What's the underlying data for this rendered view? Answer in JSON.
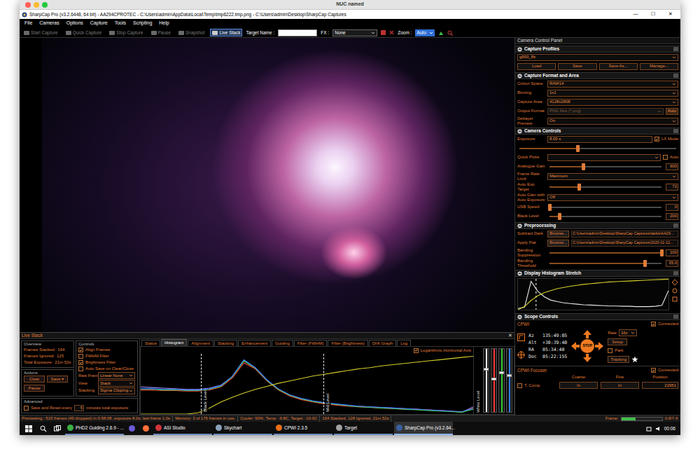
{
  "mac_window": {
    "title": "NUC named"
  },
  "window": {
    "title": "SharpCap Pro (v3.2.6448, 64 bit) - AA294CPROTEC - C:\\Users\\admin\\AppData\\Local\\Temp\\tmp6222.tmp.png - C:\\Users\\admin\\Desktop\\SharpCap Captures",
    "controls": [
      "—",
      "☐",
      "✕"
    ]
  },
  "menu": [
    "File",
    "Cameras",
    "Options",
    "Capture",
    "Tools",
    "Scripting",
    "Help"
  ],
  "toolbar": {
    "buttons": [
      {
        "label": "Start Capture",
        "disabled": true,
        "selected": false
      },
      {
        "label": "Quick Capture",
        "disabled": true,
        "selected": false
      },
      {
        "label": "Stop Capture",
        "disabled": true,
        "selected": false
      },
      {
        "label": "Pause",
        "disabled": true,
        "selected": false
      },
      {
        "label": "Snapshot",
        "disabled": true,
        "selected": false
      },
      {
        "label": "Live Stack",
        "disabled": false,
        "selected": true
      }
    ],
    "target_label": "Target Name :",
    "fx_label": "FX :",
    "fx_value": "None",
    "zoom_label": "Zoom :",
    "zoom_value": "Auto"
  },
  "camera_panel": {
    "title": "Camera Control Panel",
    "sections": [
      {
        "title": "Capture Profiles",
        "expanded": true,
        "rows": [
          {
            "kind": "select",
            "value": "g900_8s",
            "disabled": false
          },
          {
            "kind": "buttons",
            "buttons": [
              "Load",
              "Save",
              "Save As...",
              "Manage..."
            ]
          }
        ]
      },
      {
        "title": "Capture Format and Area",
        "expanded": true,
        "rows": [
          {
            "kind": "select",
            "label": "Colour Space",
            "value": "RAW14",
            "disabled": false
          },
          {
            "kind": "select",
            "label": "Binning",
            "value": "1x1",
            "disabled": false
          },
          {
            "kind": "select",
            "label": "Capture Area",
            "value": "4128x2808",
            "disabled": false
          },
          {
            "kind": "select",
            "label": "Output Format",
            "value": "PNG files (*.png)",
            "disabled": true,
            "button": "Auto"
          },
          {
            "kind": "select",
            "label": "Debayer Preview",
            "value": "On",
            "disabled": false
          }
        ]
      },
      {
        "title": "Camera Controls",
        "expanded": true,
        "rows": [
          {
            "kind": "input_check",
            "label": "Exposure",
            "value": "8.00 s",
            "check": "LX Mode",
            "checked": true
          },
          {
            "kind": "slider",
            "level": 0.37
          },
          {
            "kind": "select_check",
            "label": "Quick Picks",
            "check": "Auto",
            "checked": false
          },
          {
            "kind": "slider",
            "label": "Analogue Gain",
            "reading": "900",
            "level": 0.3
          },
          {
            "kind": "select",
            "label": "Frame Rate Limit",
            "value": "Maximum",
            "disabled": false
          },
          {
            "kind": "slider",
            "label": "Auto Exp Target",
            "reading": "72",
            "level": 0.26
          },
          {
            "kind": "select",
            "label": "Auto Gain with Auto Exposure",
            "value": "Off",
            "disabled": false
          },
          {
            "kind": "slider",
            "label": "USB Speed",
            "reading": "0",
            "level": 0
          },
          {
            "kind": "slider",
            "label": "Black Level",
            "reading": "200",
            "level": 0.09
          }
        ]
      },
      {
        "title": "Preprocessing",
        "expanded": true,
        "rows": [
          {
            "kind": "browse",
            "label": "Subtract Dark",
            "button": "Browse...",
            "value": "C:\\Users\\admin\\Desktop\\SharpCap Captures\\darks\\AA29..."
          },
          {
            "kind": "browse",
            "label": "Apply Flat",
            "button": "Browse...",
            "value": "C:\\Users\\admin\\Desktop\\SharpCap Captures\\2020-11-12..."
          },
          {
            "kind": "slider",
            "label": "Banding Suppression",
            "reading": "100",
            "level": 1
          },
          {
            "kind": "slider",
            "label": "Banding Threshold",
            "reading": "35.0",
            "level": 0.85
          }
        ]
      }
    ],
    "histogram_stretch": {
      "title": "Display Histogram Stretch",
      "expanded": true,
      "marker_level": 0.12,
      "series": [
        {
          "color": "#e8e8e8",
          "values": [
            4,
            8,
            92,
            60,
            42,
            31,
            26,
            22,
            20,
            18,
            16,
            15,
            14,
            13,
            12,
            12,
            11,
            11,
            10,
            10,
            10,
            11,
            14,
            62
          ]
        },
        {
          "color": "#d6cf2a",
          "values": [
            0,
            10,
            30,
            45,
            55,
            62,
            68,
            72,
            76,
            79,
            82,
            84,
            86,
            88,
            90,
            91,
            92,
            93,
            94,
            95,
            96,
            97,
            98,
            99
          ]
        }
      ]
    },
    "scope": {
      "title": "Scope Controls",
      "expanded": true,
      "mount": "CPWI",
      "connected_label": "Connected",
      "connected": true,
      "coords": [
        {
          "label": "Az",
          "value": "135:49:05"
        },
        {
          "label": "Alt",
          "value": "+30:39:40"
        },
        {
          "label": "RA",
          "value": "05:34:40"
        },
        {
          "label": "Dec",
          "value": "05:22:155"
        }
      ],
      "rate_label": "Rate",
      "rate_value": "16x",
      "setup": "Setup",
      "park_label": "Park",
      "park": false,
      "tracking": "Tracking",
      "stop": "STOP"
    },
    "focuser": {
      "title": "CPWI Focuser",
      "connected_label": "Connected",
      "connected": true,
      "columns": [
        "Coarse",
        "Fine",
        "Position"
      ],
      "tcomp_label": "T. Comp",
      "tcomp": false,
      "buttons": [
        "In",
        "In"
      ],
      "position": "22951"
    }
  },
  "live_stack": {
    "title": "Live Stack",
    "close": "✕",
    "overview": {
      "title": "Overview",
      "items": [
        {
          "label": "Frames Stacked:",
          "value": "164"
        },
        {
          "label": "Frames Ignored:",
          "value": "125"
        },
        {
          "label": "Total Exposure:",
          "value": "21m 52s"
        }
      ]
    },
    "controls": {
      "title": "Controls",
      "checks": [
        {
          "label": "Align Frames",
          "checked": true
        },
        {
          "label": "FWHM Filter",
          "checked": false
        },
        {
          "label": "Brightness Filter",
          "checked": true
        },
        {
          "label": "Auto Save on Clear/Close",
          "checked": false
        }
      ],
      "selects": [
        {
          "label": "Raw Frames",
          "value": "Linear None"
        },
        {
          "label": "View",
          "value": "Stack"
        },
        {
          "label": "Stacking",
          "value": "Sigma Clipping"
        }
      ]
    },
    "actions": {
      "title": "Actions",
      "buttons": [
        {
          "label": "Clear"
        },
        {
          "label": "Save",
          "menu": "▾"
        },
        {
          "label": "Pause"
        }
      ]
    },
    "advanced": {
      "title": "Advanced",
      "check_label": "Save and Reset every",
      "checked": false,
      "value": "5",
      "suffix": "minutes total exposure"
    },
    "tabs": [
      {
        "label": "Status",
        "selected": false
      },
      {
        "label": "Histogram",
        "selected": true
      },
      {
        "label": "Alignment",
        "selected": false
      },
      {
        "label": "Stacking",
        "selected": false
      },
      {
        "label": "Enhancement",
        "selected": false
      },
      {
        "label": "Guiding",
        "selected": false
      },
      {
        "label": "Filter (FWHM)",
        "selected": false
      },
      {
        "label": "Filter (Brightness)",
        "selected": false
      },
      {
        "label": "Drift Graph",
        "selected": false
      },
      {
        "label": "Log",
        "selected": false
      }
    ],
    "histogram": {
      "log_label": "Logarithmic Horizontal Axis",
      "log_checked": true,
      "series": [
        {
          "color": "#9a8cff",
          "values": [
            45,
            44,
            43,
            42,
            41,
            41,
            43,
            48,
            62,
            89,
            76,
            56,
            41,
            31,
            25,
            21,
            18,
            16,
            14,
            13,
            12,
            11,
            10,
            9,
            8,
            7,
            6,
            5,
            3,
            12
          ]
        },
        {
          "color": "#ff3b3b",
          "values": [
            40,
            40,
            39,
            39,
            38,
            38,
            40,
            45,
            60,
            85,
            75,
            55,
            40,
            30,
            24,
            20,
            17,
            15,
            13,
            12,
            11,
            10,
            9,
            8,
            8,
            7,
            6,
            5,
            3,
            10
          ]
        },
        {
          "color": "#38d038",
          "values": [
            41,
            41,
            40,
            40,
            39,
            39,
            41,
            46,
            62,
            88,
            76,
            56,
            41,
            31,
            25,
            21,
            18,
            16,
            14,
            12,
            11,
            10,
            9,
            8,
            7,
            6,
            5,
            4,
            3,
            8
          ]
        },
        {
          "color": "#3b7dff",
          "values": [
            42,
            42,
            41,
            41,
            40,
            40,
            42,
            47,
            63,
            90,
            77,
            57,
            42,
            32,
            26,
            22,
            19,
            17,
            15,
            13,
            12,
            11,
            10,
            9,
            8,
            7,
            6,
            5,
            4,
            9
          ]
        },
        {
          "color": "#d6cf2a",
          "values": [
            0,
            0,
            0,
            0,
            0,
            2,
            10,
            20,
            28,
            35,
            41,
            46,
            51,
            55,
            59,
            63,
            66,
            69,
            72,
            75,
            77,
            80,
            82,
            84,
            86,
            88,
            90,
            92,
            94,
            96
          ]
        }
      ],
      "markers": [
        {
          "label": "Black Level",
          "level": 0.18
        },
        {
          "label": "Mid Level",
          "level": 0.55
        }
      ],
      "white_label": "White Level",
      "channels": [
        {
          "color": "#ffffff",
          "level": 0.3
        },
        {
          "color": "#ff3030",
          "level": 0.45
        },
        {
          "color": "#30d030",
          "level": 0.35
        },
        {
          "color": "#3080ff",
          "level": 0.4
        }
      ]
    }
  },
  "status_bar": [
    "Previewing : 515 frames (49 dropped) in 0:58:08, exposure 8.0s, last frame 1.0s",
    "Memory: 3 of 176 frames in use.",
    "Cooler: 50%, Temp: -9.8C, Target: -10.0C",
    "164 Stacked, 128 Ignored, 21m 52s"
  ],
  "frame": {
    "label": "Frame:",
    "level": 0.35,
    "reading": "0.8/7.4"
  },
  "taskbar": {
    "items": [
      {
        "kind": "app",
        "label": "PHD2 Guiding 2.6.9 - ...",
        "color": "#3cb043",
        "selected": false
      },
      {
        "kind": "icon",
        "color": "#6b5bd6",
        "selected": false
      },
      {
        "kind": "icon",
        "color": "#ff7139",
        "selected": false
      },
      {
        "kind": "app",
        "label": "ASI Studio",
        "color": "#d0343a",
        "selected": false
      },
      {
        "kind": "app",
        "label": "Skychart",
        "color": "#8aa0b8",
        "selected": false
      },
      {
        "kind": "app",
        "label": "CPWI 2.3.5",
        "color": "#e8701a",
        "selected": false
      },
      {
        "kind": "app",
        "label": "Target",
        "color": "#a0a0a0",
        "selected": false
      },
      {
        "kind": "app",
        "label": "SharpCap Pro (v3.2.64...",
        "color": "#3a5fa0",
        "selected": true
      }
    ],
    "clock": "00:06"
  }
}
